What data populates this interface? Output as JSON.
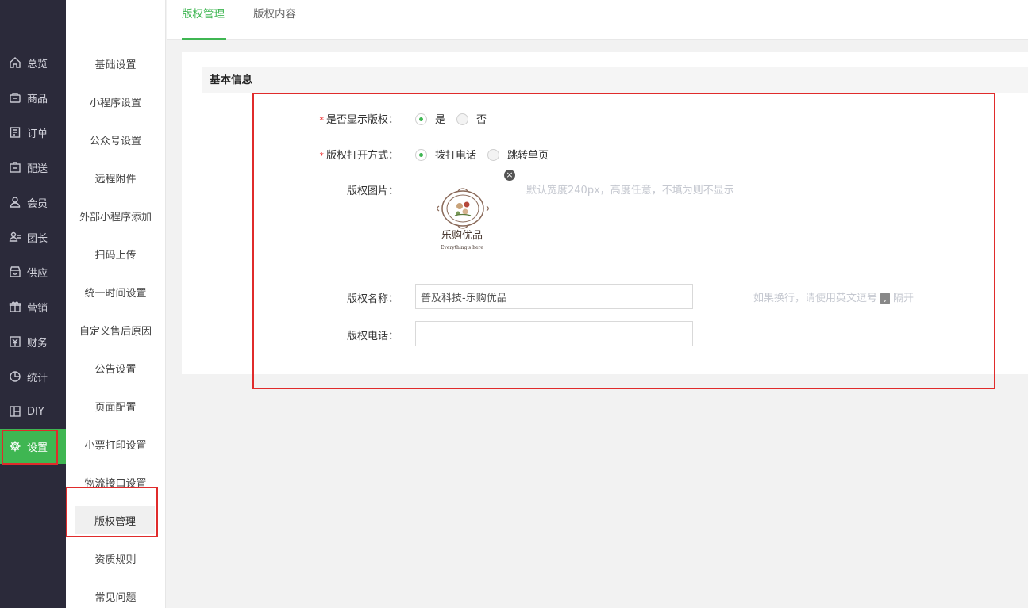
{
  "nav": {
    "items": [
      {
        "label": "总览",
        "icon": "home-icon"
      },
      {
        "label": "商品",
        "icon": "goods-icon"
      },
      {
        "label": "订单",
        "icon": "order-icon"
      },
      {
        "label": "配送",
        "icon": "delivery-icon"
      },
      {
        "label": "会员",
        "icon": "member-icon"
      },
      {
        "label": "团长",
        "icon": "leader-icon"
      },
      {
        "label": "供应",
        "icon": "supply-icon"
      },
      {
        "label": "营销",
        "icon": "gift-icon"
      },
      {
        "label": "财务",
        "icon": "finance-icon"
      },
      {
        "label": "统计",
        "icon": "pie-chart-icon"
      },
      {
        "label": "DIY",
        "icon": "layout-icon"
      },
      {
        "label": "设置",
        "icon": "gear-icon"
      }
    ],
    "active_index": 11
  },
  "subnav": {
    "items": [
      "基础设置",
      "小程序设置",
      "公众号设置",
      "远程附件",
      "外部小程序添加",
      "扫码上传",
      "统一时间设置",
      "自定义售后原因",
      "公告设置",
      "页面配置",
      "小票打印设置",
      "物流接口设置",
      "版权管理",
      "资质规则",
      "常见问题"
    ],
    "active_index": 12
  },
  "tabs": [
    {
      "label": "版权管理",
      "active": true
    },
    {
      "label": "版权内容",
      "active": false
    }
  ],
  "section": {
    "title": "基本信息"
  },
  "form": {
    "show_copyright": {
      "required_mark": "*",
      "label": "是否显示版权：",
      "options": [
        "是",
        "否"
      ],
      "selected": "是"
    },
    "open_method": {
      "required_mark": "*",
      "label": "版权打开方式：",
      "options": [
        "拨打电话",
        "跳转单页"
      ],
      "selected": "拨打电话"
    },
    "image": {
      "label": "版权图片：",
      "hint": "默认宽度240px，高度任意，不填为则不显示",
      "close_glyph": "×",
      "logo_text": "乐购优品",
      "logo_tagline": "Everything's here"
    },
    "name": {
      "label": "版权名称：",
      "value": "普及科技-乐购优品",
      "hint_before": "如果换行，请使用英文逗号",
      "hint_chip": ",",
      "hint_after": "隔开"
    },
    "phone": {
      "label": "版权电话：",
      "value": ""
    }
  },
  "colors": {
    "accent": "#3fb652",
    "nav_bg": "#2b2a3a",
    "annotation": "#e02b2b",
    "required": "#e33333"
  }
}
